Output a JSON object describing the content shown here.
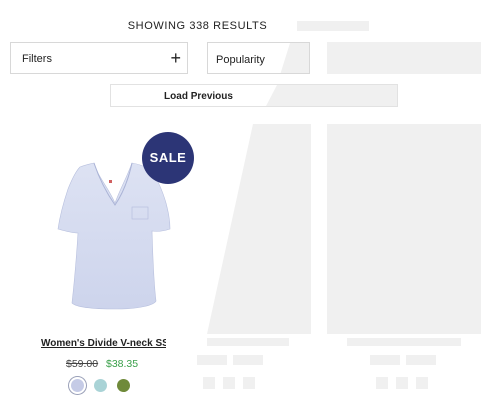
{
  "results": {
    "count_text": "SHOWING 338 RESULTS"
  },
  "filters": {
    "label": "Filters",
    "expand_icon": "plus-icon"
  },
  "sort": {
    "selected": "Popularity"
  },
  "load_previous": {
    "label": "Load Previous"
  },
  "product": {
    "badge": "SALE",
    "title": "Women's Divide V-neck SS",
    "original_price": "$59.00",
    "sale_price": "$38.35",
    "swatches": [
      {
        "name": "light-blue",
        "color": "#c5cbe6",
        "selected": true
      },
      {
        "name": "aqua",
        "color": "#a9d3d6",
        "selected": false
      },
      {
        "name": "olive",
        "color": "#6f8a3a",
        "selected": false
      }
    ]
  },
  "colors": {
    "badge_bg": "#2c3576",
    "sale_price": "#3aa04a",
    "skeleton": "#f0f0f0"
  }
}
